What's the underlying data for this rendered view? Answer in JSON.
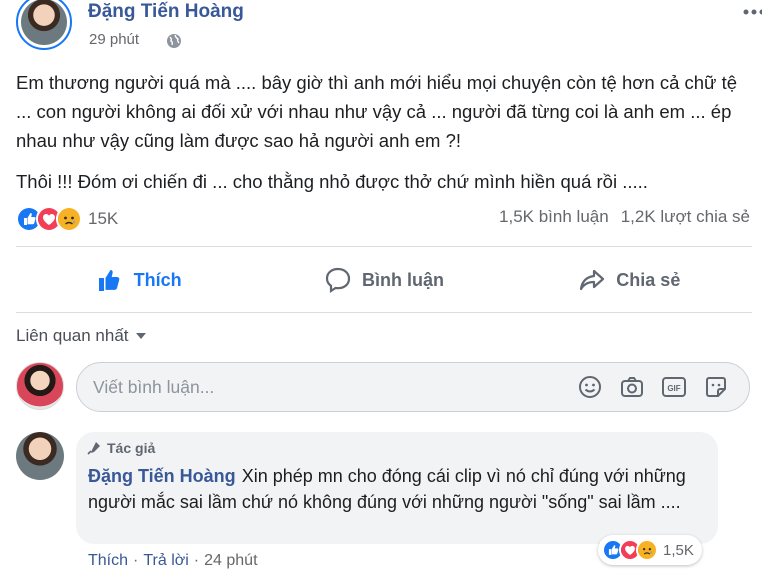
{
  "post": {
    "author": "Đặng Tiến Hoàng",
    "time": "29 phút",
    "paragraphs": [
      "Em thương người quá mà .... bây giờ thì anh mới hiểu mọi chuyện còn tệ hơn cả chữ tệ ... con người không ai đối xử với nhau như vậy cả ... người đã từng coi là anh em ... ép nhau như vậy cũng làm được sao hả người anh em ?!",
      "Thôi !!! Đóm ơi chiến đi ... cho thằng nhỏ được thở chứ mình hiền quá rồi ....."
    ],
    "reaction_count": "15K",
    "comments_count": "1,5K bình luận",
    "shares_count": "1,2K lượt chia sẻ"
  },
  "actions": {
    "like": "Thích",
    "comment": "Bình luận",
    "share": "Chia sẻ"
  },
  "sort": {
    "label": "Liên quan nhất"
  },
  "comment_input": {
    "placeholder": "Viết bình luận..."
  },
  "comment": {
    "badge": "Tác giả",
    "author": "Đặng Tiến Hoàng",
    "text": "Xin phép mn cho đóng cái clip vì nó chỉ đúng với những người mắc sai lầm chứ nó không đúng với những người \"sống\" sai lầm ....",
    "like_link": "Thích",
    "reply_link": "Trả lời",
    "time": "24 phút",
    "reaction_count": "1,5K"
  },
  "colors": {
    "brand_blue": "#1877f2",
    "name_blue": "#385898",
    "love_red": "#f33e58",
    "sad_yellow": "#f7b125"
  }
}
